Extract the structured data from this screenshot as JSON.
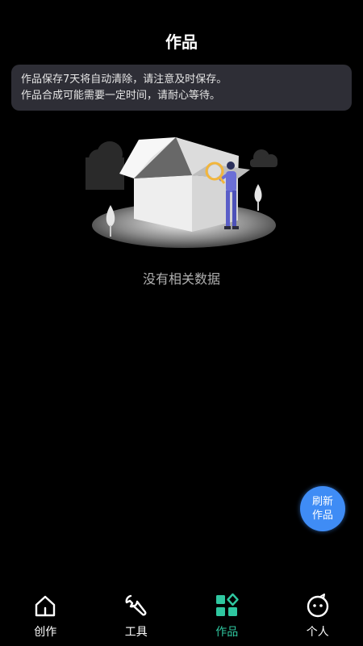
{
  "header": {
    "title": "作品"
  },
  "notice": {
    "line1": "作品保存7天将自动清除，请注意及时保存。",
    "line2": "作品合成可能需要一定时间，请耐心等待。"
  },
  "empty_state": {
    "text": "没有相关数据"
  },
  "refresh_button": {
    "line1": "刷新",
    "line2": "作品",
    "color": "#3f8cf5"
  },
  "tabbar": {
    "items": [
      {
        "label": "创作",
        "icon": "home-icon",
        "active": false
      },
      {
        "label": "工具",
        "icon": "wrench-icon",
        "active": false
      },
      {
        "label": "作品",
        "icon": "works-icon",
        "active": true
      },
      {
        "label": "个人",
        "icon": "profile-icon",
        "active": false
      }
    ],
    "active_color": "#2fc7a0"
  }
}
